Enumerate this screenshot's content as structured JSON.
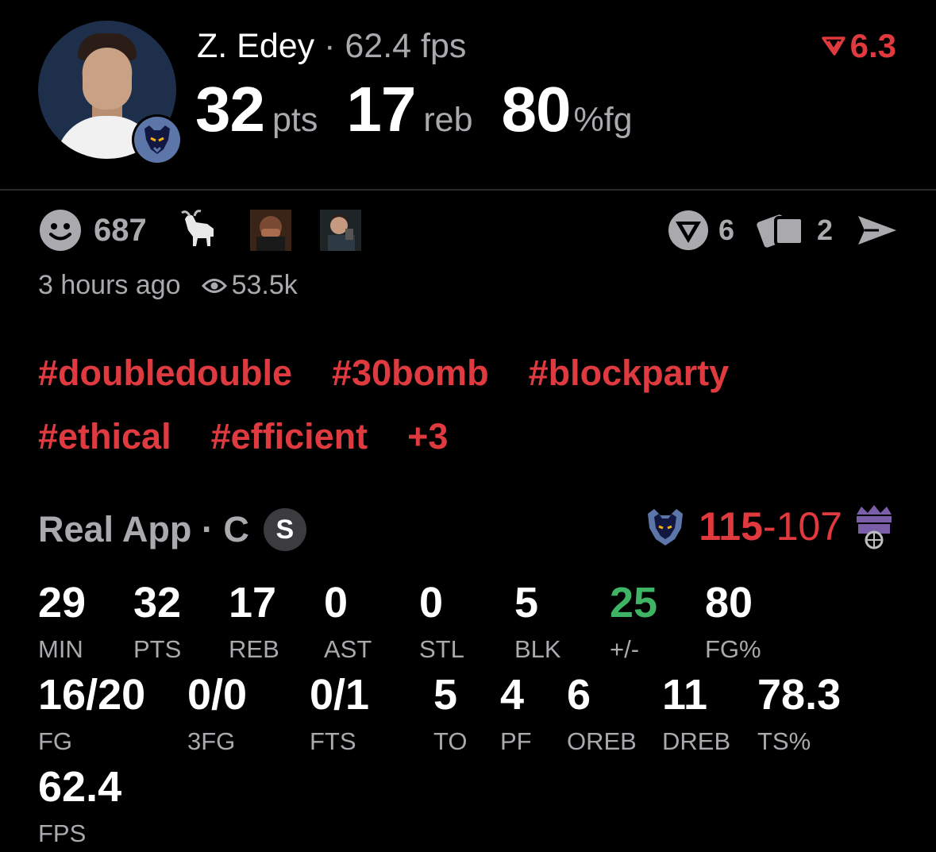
{
  "player": {
    "name": "Z. Edey",
    "separator": " · ",
    "fps_text": "62.4 fps"
  },
  "rating": {
    "value": "6.3",
    "color": "#e0393e"
  },
  "headline": [
    {
      "value": "32",
      "unit": "pts"
    },
    {
      "value": "17",
      "unit": "reb"
    },
    {
      "value": "80",
      "unit": "%fg"
    }
  ],
  "reactions": {
    "count": "687"
  },
  "actions": {
    "comments": "6",
    "shares": "2"
  },
  "meta": {
    "time": "3 hours ago",
    "views": "53.5k"
  },
  "tags": {
    "row1": [
      "#doubledouble",
      "#30bomb",
      "#blockparty"
    ],
    "row2": [
      "#ethical",
      "#efficient",
      "+3"
    ]
  },
  "source": {
    "text": "Real App · C",
    "badge": "S"
  },
  "score": {
    "home": "115",
    "sep": "-",
    "away": "107"
  },
  "stats_row1": [
    {
      "value": "29",
      "label": "MIN"
    },
    {
      "value": "32",
      "label": "PTS"
    },
    {
      "value": "17",
      "label": "REB"
    },
    {
      "value": "0",
      "label": "AST"
    },
    {
      "value": "0",
      "label": "STL"
    },
    {
      "value": "5",
      "label": "BLK"
    },
    {
      "value": "25",
      "label": "+/-"
    },
    {
      "value": "80",
      "label": "FG%"
    }
  ],
  "stats_row2": [
    {
      "value": "16/20",
      "label": "FG"
    },
    {
      "value": "0/0",
      "label": "3FG"
    },
    {
      "value": "0/1",
      "label": "FTS"
    },
    {
      "value": "5",
      "label": "TO"
    },
    {
      "value": "4",
      "label": "PF"
    },
    {
      "value": "6",
      "label": "OREB"
    },
    {
      "value": "11",
      "label": "DREB"
    },
    {
      "value": "78.3",
      "label": "TS%"
    }
  ],
  "stats_row3": [
    {
      "value": "62.4",
      "label": "FPS"
    }
  ],
  "colors": {
    "accent_red": "#e0393e",
    "positive_green": "#3fb464",
    "muted": "#a9a9ae"
  }
}
